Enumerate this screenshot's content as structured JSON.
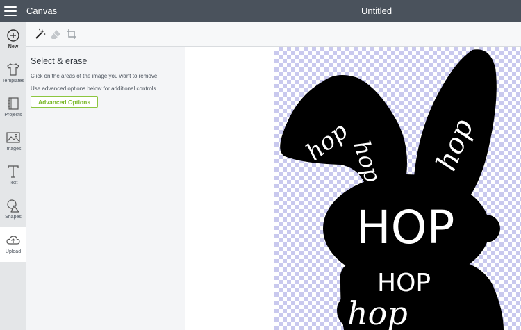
{
  "topbar": {
    "app_title": "Canvas",
    "doc_title": "Untitled"
  },
  "nav": {
    "items": [
      {
        "label": "New",
        "icon": "plus-circle-icon"
      },
      {
        "label": "Templates",
        "icon": "tshirt-icon"
      },
      {
        "label": "Projects",
        "icon": "notebook-icon"
      },
      {
        "label": "Images",
        "icon": "image-icon"
      },
      {
        "label": "Text",
        "icon": "text-t-icon"
      },
      {
        "label": "Shapes",
        "icon": "shapes-icon"
      },
      {
        "label": "Upload",
        "icon": "cloud-upload-icon"
      }
    ],
    "active": "Upload"
  },
  "toolbar": {
    "tools": [
      "magic-wand-icon",
      "eraser-icon",
      "crop-icon"
    ]
  },
  "panel": {
    "title": "Select & erase",
    "text1": "Click on the areas of the image you want to remove.",
    "text2": "Use advanced options below for additional controls.",
    "advanced_button": "Advanced Options"
  },
  "canvas": {
    "artwork_words": [
      "hop",
      "hop",
      "hop",
      "HOP",
      "HOP",
      "hop"
    ]
  },
  "colors": {
    "topbar": "#4a525c",
    "accent_green": "#8cc63f",
    "checker": "#c9c9ee",
    "artwork": "#000000"
  }
}
